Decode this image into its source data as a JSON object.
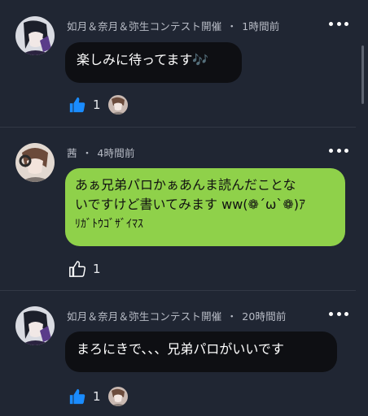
{
  "comments": [
    {
      "author": "如月＆奈月＆弥生コンテスト開催",
      "separator": "・",
      "time": "1時間前",
      "text": "楽しみに待ってます🎶",
      "like_count": "1"
    },
    {
      "author": "茜",
      "separator": "・",
      "time": "4時間前",
      "text_line1": "あぁ兄弟パロかぁあんま読んだことな",
      "text_line2": "いですけど書いてみます ww(❁´ω`❁)ｱ",
      "text_line3": "ﾘｶﾞﾄｳｺﾞｻﾞｲﾏｽ",
      "like_count": "1"
    },
    {
      "author": "如月＆奈月＆弥生コンテスト開催",
      "separator": "・",
      "time": "20時間前",
      "text": "まろにきで、、、兄弟パロがいいです",
      "like_count": "1"
    }
  ],
  "colors": {
    "background": "#202633",
    "bubble_dark": "#0e0f13",
    "bubble_green": "#8fd14a",
    "like_active": "#1a8cff"
  },
  "icons": {
    "more": "more-horizontal-icon",
    "like_filled": "thumbs-up-filled-icon",
    "like_outline": "thumbs-up-outline-icon"
  }
}
